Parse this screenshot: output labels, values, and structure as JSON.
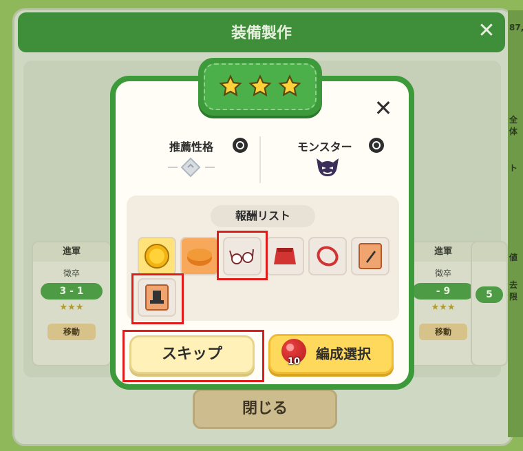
{
  "window": {
    "title": "装備製作",
    "close_icon": "close-icon"
  },
  "right_strip": [
    "87,",
    "ト",
    "全体",
    "値",
    "去限"
  ],
  "stage_cards": [
    {
      "header": "進軍",
      "subtitle": "徴卒",
      "level": "3 - 1",
      "stars": "★★★",
      "move_label": "移動"
    },
    {
      "header": "進軍",
      "subtitle": "徴卒",
      "level": "- 9",
      "stars": "★★★",
      "move_label": "移動"
    },
    {
      "header": "",
      "subtitle": "",
      "level": "5",
      "stars": "",
      "move_label": ""
    }
  ],
  "close_button": "閉じる",
  "modal": {
    "stars": 3,
    "recommended_label": "推薦性格",
    "monster_label": "モンスター",
    "reward_title": "報酬リスト",
    "rewards": [
      {
        "icon": "gold-coin-icon"
      },
      {
        "icon": "orange-pancake-icon"
      },
      {
        "icon": "glasses-icon",
        "highlighted": true
      },
      {
        "icon": "red-cape-icon"
      },
      {
        "icon": "red-ring-icon"
      },
      {
        "icon": "scroll-sword-icon"
      },
      {
        "icon": "scroll-hat-icon",
        "highlighted": true
      }
    ],
    "skip_label": "スキップ",
    "team_label": "編成選択",
    "team_count": "10"
  },
  "colors": {
    "accent_green": "#3c9a3b",
    "highlight": "#e01b1b",
    "button_yellow": "#ffd95b"
  }
}
